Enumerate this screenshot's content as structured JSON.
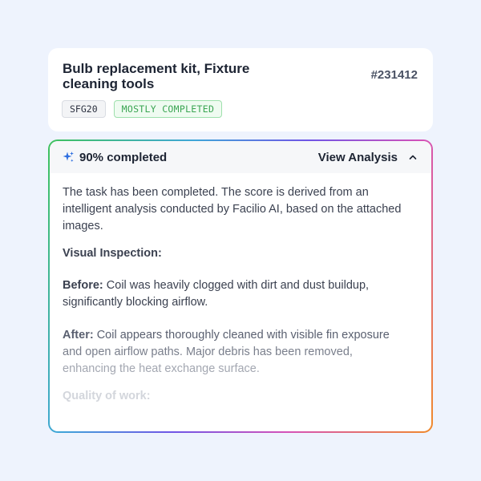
{
  "task": {
    "title": "Bulb replacement kit, Fixture cleaning tools",
    "id": "#231412",
    "tags": {
      "code": "SFG20",
      "status": "MOSTLY COMPLETED"
    }
  },
  "analysis": {
    "sparkle_icon": "sparkle-icon",
    "completed_label": "90% completed",
    "view_label": "View Analysis",
    "chevron_icon": "chevron-up-icon",
    "intro": "The task has been completed. The score is derived from an intelligent analysis conducted by Facilio AI, based on the attached images.",
    "visual_heading": "Visual Inspection:",
    "before_label": "Before:",
    "before_text": " Coil was heavily clogged with dirt and dust buildup, significantly blocking airflow.",
    "after_label": "After:",
    "after_line1": " Coil appears thoroughly cleaned with visible fin exposure",
    "after_line2": "and open airflow paths. Major debris has been removed,",
    "after_line3": "enhancing the heat exchange surface.",
    "quality_heading": "Quality of work:"
  },
  "colors": {
    "background": "#eef3fd",
    "status_green": "#3aa552",
    "sparkle_blue": "#2f6fe0"
  }
}
